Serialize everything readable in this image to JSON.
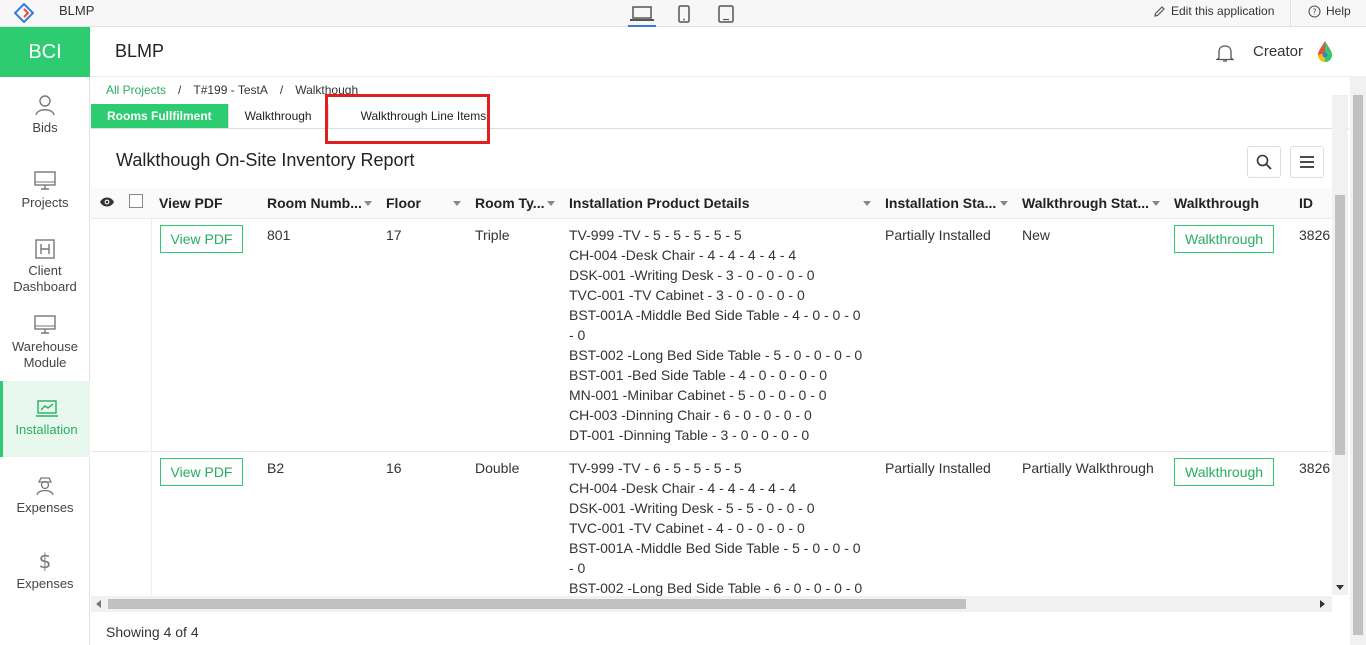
{
  "topbar": {
    "app_name": "BLMP",
    "edit_label": "Edit this application",
    "help_label": "Help"
  },
  "sidebar": {
    "brand": "BCI",
    "items": [
      {
        "label": "Bids",
        "icon": "user-icon"
      },
      {
        "label": "Projects",
        "icon": "monitor-icon"
      },
      {
        "label": "Client Dashboard",
        "icon": "dashboard-icon"
      },
      {
        "label": "Warehouse Module",
        "icon": "monitor-icon"
      },
      {
        "label": "Installation",
        "icon": "chart-icon"
      },
      {
        "label": "Expenses",
        "icon": "person-icon"
      },
      {
        "label": "Expenses",
        "icon": "dollar-icon"
      }
    ]
  },
  "header": {
    "title": "BLMP",
    "user": "Creator"
  },
  "breadcrumb": [
    "All Projects",
    "T#199 - TestA",
    "Walkthough"
  ],
  "tabs": [
    "Rooms Fullfilment",
    "Walkthrough",
    "Walkthrough Line Items"
  ],
  "report": {
    "title": "Walkthough On-Site Inventory Report",
    "columns": [
      "View PDF",
      "Room Numb...",
      "Floor",
      "Room Ty...",
      "Installation Product Details",
      "Installation Sta...",
      "Walkthrough Stat...",
      "Walkthrough",
      "ID"
    ],
    "rows": [
      {
        "view_pdf": "View PDF",
        "room": "801",
        "floor": "17",
        "type": "Triple",
        "products": [
          "TV-999 -TV - 5 - 5 - 5 - 5 - 5",
          "CH-004 -Desk Chair - 4 - 4 - 4 - 4 - 4",
          "DSK-001 -Writing Desk - 3 - 0 - 0 - 0 - 0",
          "TVC-001 -TV Cabinet - 3 - 0 - 0 - 0 - 0",
          "BST-001A -Middle Bed Side Table - 4 - 0 - 0 - 0 - 0",
          "BST-002 -Long Bed Side Table - 5 - 0 - 0 - 0 - 0",
          "BST-001 -Bed Side Table - 4 - 0 - 0 - 0 - 0",
          "MN-001 -Minibar Cabinet - 5 - 0 - 0 - 0 - 0",
          "CH-003 -Dinning Chair - 6 - 0 - 0 - 0 - 0",
          "DT-001 -Dinning Table - 3 - 0 - 0 - 0 - 0"
        ],
        "install_status": "Partially Installed",
        "walk_status": "New",
        "walkthrough": "Walkthrough",
        "id": "3826"
      },
      {
        "view_pdf": "View PDF",
        "room": "B2",
        "floor": "16",
        "type": "Double",
        "products": [
          "TV-999 -TV - 6 - 5 - 5 - 5 - 5",
          "CH-004 -Desk Chair - 4 - 4 - 4 - 4 - 4",
          "DSK-001 -Writing Desk - 5 - 5 - 0 - 0 - 0",
          "TVC-001 -TV Cabinet - 4 - 0 - 0 - 0 - 0",
          "BST-001A -Middle Bed Side Table - 5 - 0 - 0 - 0 - 0",
          "BST-002 -Long Bed Side Table - 6 - 0 - 0 - 0 - 0"
        ],
        "install_status": "Partially Installed",
        "walk_status": "Partially Walkthrough",
        "walkthrough": "Walkthrough",
        "id": "3826"
      }
    ]
  },
  "footer": {
    "showing": "Showing 4 of 4"
  },
  "colors": {
    "accent": "#2ecc71",
    "highlight": "#e02020"
  }
}
